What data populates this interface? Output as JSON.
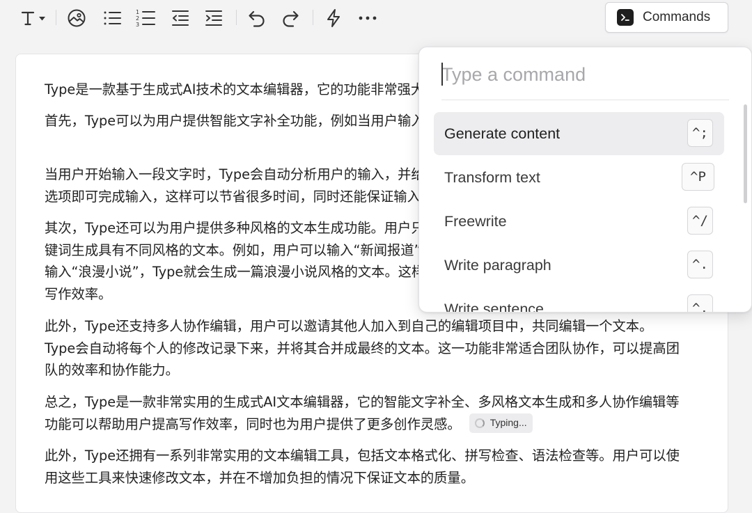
{
  "toolbar": {
    "text_style_icon": "text-type-icon",
    "commands_label": "Commands"
  },
  "editor": {
    "paragraphs": [
      "Type是一款基于生成式AI技术的文本编辑器，它的功能非常强大",
      "首先，Type可以为用户提供智能文字补全功能，例如当用户输入“今天天气很”时，Type会自动补充“好”。\"",
      "当用户开始输入一段文字时，Type会自动分析用户的输入，并给出多个补全选项，用户只需选择一个合适的选项即可完成输入，这样可以节省很多时间，同时还能保证输入的准确性。",
      "其次，Type还可以为用户提供多种风格的文本生成功能。用户只需输入一些关键词，Type就能根据这些关键词生成具有不同风格的文本。例如，用户可以输入“新闻报道”，Type就会生成一篇类似新闻的文章；用户输入“浪漫小说”，Type就会生成一篇浪漫小说风格的文本。这样可以快速生成各种类型的文本，为用户提高写作效率。",
      "此外，Type还支持多人协作编辑，用户可以邀请其他人加入到自己的编辑项目中，共同编辑一个文本。Type会自动将每个人的修改记录下来，并将其合并成最终的文本。这一功能非常适合团队协作，可以提高团队的效率和协作能力。",
      "总之，Type是一款非常实用的生成式AI文本编辑器，它的智能文字补全、多风格文本生成和多人协作编辑等功能可以帮助用户提高写作效率，同时也为用户提供了更多创作灵感。",
      "此外，Type还拥有一系列非常实用的文本编辑工具，包括文本格式化、拼写检查、语法检查等。用户可以使用这些工具来快速修改文本，并在不增加负担的情况下保证文本的质量。"
    ],
    "typing_label": "Typing..."
  },
  "palette": {
    "placeholder": "Type a command",
    "items": [
      {
        "label": "Generate content",
        "shortcut": "^;"
      },
      {
        "label": "Transform text",
        "shortcut": "^P"
      },
      {
        "label": "Freewrite",
        "shortcut": "^/"
      },
      {
        "label": "Write paragraph",
        "shortcut": "^."
      },
      {
        "label": "Write sentence",
        "shortcut": "^,"
      }
    ]
  }
}
